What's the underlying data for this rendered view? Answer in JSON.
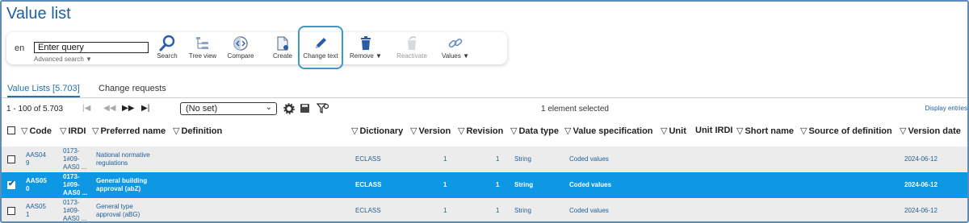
{
  "page": {
    "title": "Value list"
  },
  "toolbar": {
    "language": "en",
    "query_value": "Enter query",
    "advanced_search": "Advanced search ▼",
    "buttons": {
      "search": "Search",
      "tree_view": "Tree view",
      "compare": "Compare",
      "create": "Create",
      "change_text": "Change text",
      "remove": "Remove ▼",
      "reactivate": "Reactivate",
      "values": "Values ▼"
    }
  },
  "tabs": [
    {
      "label": "Value Lists [5.703]"
    },
    {
      "label": "Change requests"
    }
  ],
  "pager": {
    "range": "1 - 100 of 5.703",
    "view_select": "(No set)",
    "selected_info": "1 element selected",
    "display_entries": "Display entries"
  },
  "columns": {
    "code": "Code",
    "irdi": "IRDI",
    "preferred_name": "Preferred name",
    "definition": "Definition",
    "dictionary": "Dictionary",
    "version": "Version",
    "revision": "Revision",
    "data_type": "Data type",
    "value_specification": "Value specification",
    "unit": "Unit",
    "unit_irdi": "Unit IRDI",
    "short_name": "Short name",
    "source_of_definition": "Source of definition",
    "version_date": "Version date"
  },
  "rows": [
    {
      "code_1": "AAS04",
      "code_2": "9",
      "irdi_1": "0173-",
      "irdi_2": "1#09-",
      "irdi_3": "AAS0 ...",
      "name_1": "National normative",
      "name_2": "regulations",
      "dictionary": "ECLASS",
      "version": "1",
      "revision": "1",
      "data_type": "String",
      "value_spec": "Coded values",
      "version_date": "2024-06-12",
      "selected": false
    },
    {
      "code_1": "AAS05",
      "code_2": "0",
      "irdi_1": "0173-",
      "irdi_2": "1#09-",
      "irdi_3": "AAS0 ...",
      "name_1": "General building",
      "name_2": "approval (abZ)",
      "dictionary": "ECLASS",
      "version": "1",
      "revision": "1",
      "data_type": "String",
      "value_spec": "Coded values",
      "version_date": "2024-06-12",
      "selected": true
    },
    {
      "code_1": "AAS05",
      "code_2": "1",
      "irdi_1": "0173-",
      "irdi_2": "1#09-",
      "irdi_3": "AAS0 ...",
      "name_1": "General type",
      "name_2": "approval (aBG)",
      "dictionary": "ECLASS",
      "version": "1",
      "revision": "1",
      "data_type": "String",
      "value_spec": "Coded values",
      "version_date": "2024-06-12",
      "selected": false
    }
  ],
  "colors": {
    "accent": "#1f5e97",
    "selection": "#0e98e4",
    "highlight_border": "#3d9ac2"
  }
}
